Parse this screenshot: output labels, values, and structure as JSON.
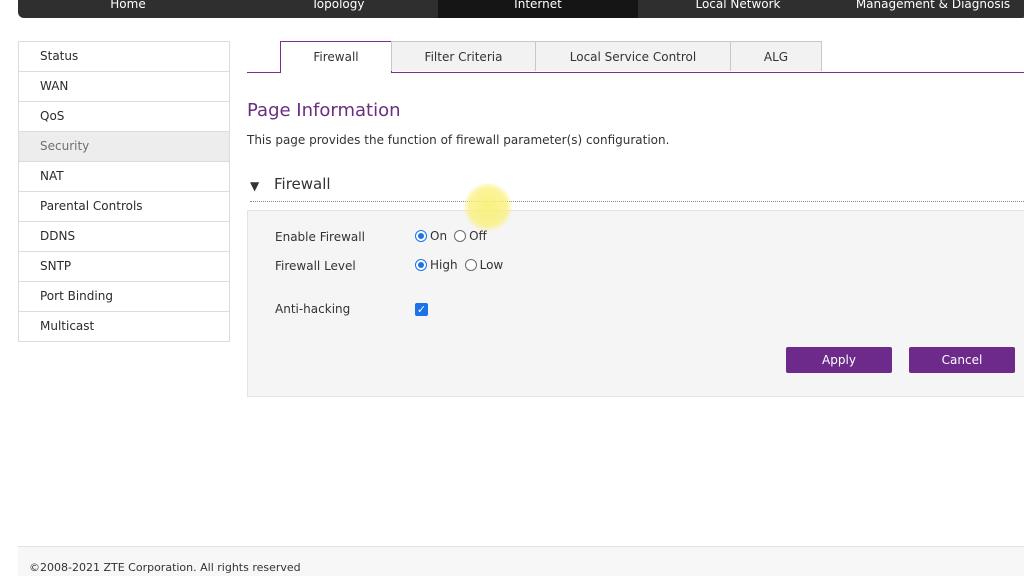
{
  "top_nav": {
    "tabs": [
      {
        "label": "Home"
      },
      {
        "label": "Topology"
      },
      {
        "label": "Internet"
      },
      {
        "label": "Local Network"
      },
      {
        "label": "Management & Diagnosis"
      }
    ],
    "active": "Internet"
  },
  "sidebar": {
    "items": [
      {
        "label": "Status"
      },
      {
        "label": "WAN"
      },
      {
        "label": "QoS"
      },
      {
        "label": "Security"
      },
      {
        "label": "NAT"
      },
      {
        "label": "Parental Controls"
      },
      {
        "label": "DDNS"
      },
      {
        "label": "SNTP"
      },
      {
        "label": "Port Binding"
      },
      {
        "label": "Multicast"
      }
    ],
    "active": "Security"
  },
  "subtabs": {
    "items": [
      {
        "label": "Firewall"
      },
      {
        "label": "Filter Criteria"
      },
      {
        "label": "Local Service Control"
      },
      {
        "label": "ALG"
      }
    ],
    "active": "Firewall"
  },
  "page_info": {
    "title": "Page Information",
    "description": "This page provides the function of firewall parameter(s) configuration."
  },
  "section": {
    "title": "Firewall",
    "collapse_icon": "triangle-down-icon"
  },
  "form": {
    "enable_firewall": {
      "label": "Enable Firewall",
      "options": [
        "On",
        "Off"
      ],
      "selected": "On"
    },
    "firewall_level": {
      "label": "Firewall Level",
      "options": [
        "High",
        "Low"
      ],
      "selected": "High"
    },
    "anti_hacking": {
      "label": "Anti-hacking",
      "checked": true
    },
    "apply_label": "Apply",
    "cancel_label": "Cancel"
  },
  "footer": {
    "copyright": "©2008-2021 ZTE Corporation. All rights reserved"
  },
  "colors": {
    "brand_purple": "#6d2a8a",
    "nav_dark": "#2f2f2f",
    "radio_blue": "#1a73e8"
  }
}
